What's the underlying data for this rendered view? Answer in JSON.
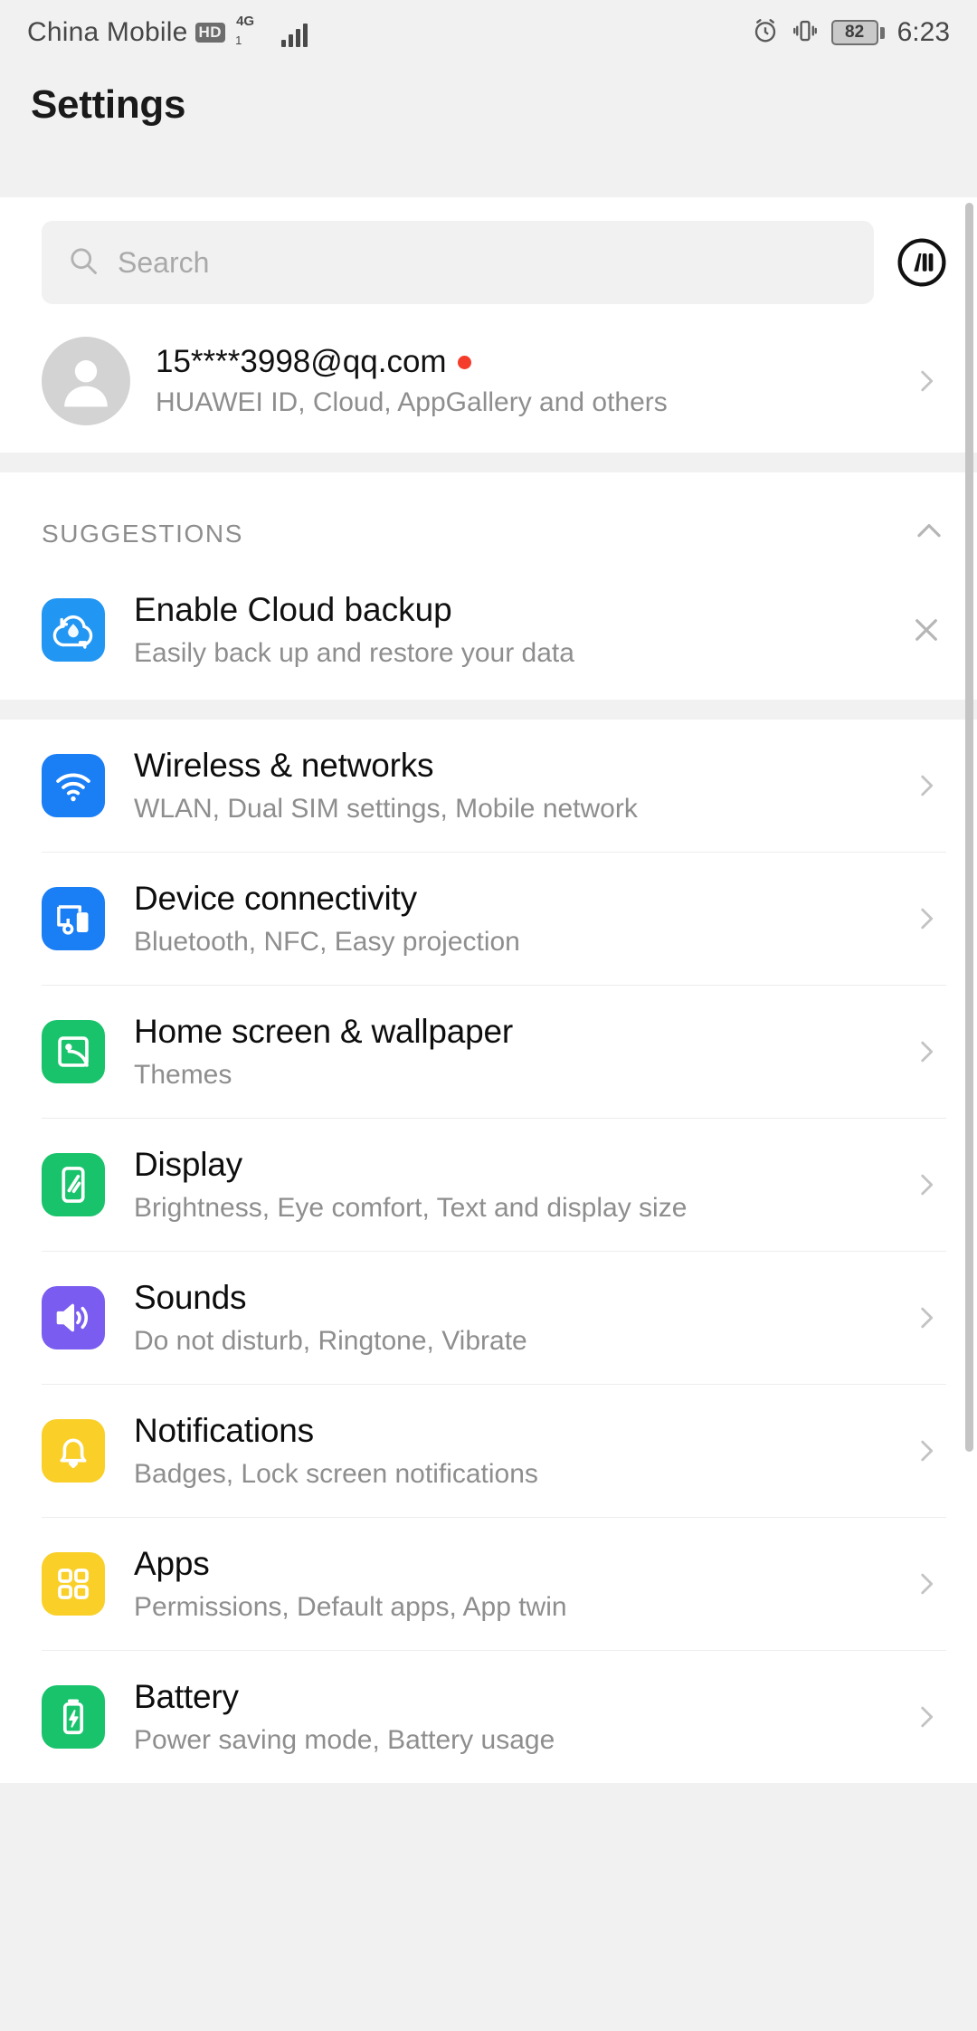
{
  "statusbar": {
    "carrier": "China Mobile",
    "hd_badge": "HD",
    "network_type": "4G",
    "network_sub": "1",
    "alarm_icon": "alarm-clock-icon",
    "vibrate_icon": "vibrate-icon",
    "battery_level": "82",
    "time": "6:23"
  },
  "header": {
    "title": "Settings"
  },
  "search": {
    "placeholder": "Search",
    "icon": "search-icon",
    "voice_icon": "hivoice-assistant-icon"
  },
  "account": {
    "name": "15****3998@qq.com",
    "subtitle": "HUAWEI ID, Cloud, AppGallery and others",
    "avatar_icon": "user-avatar-icon",
    "badge_color": "#f53c2a",
    "chevron": "chevron-right-icon"
  },
  "suggestions": {
    "section_label": "SUGGESTIONS",
    "collapse_icon": "chevron-up-icon",
    "items": [
      {
        "title": "Enable Cloud backup",
        "subtitle": "Easily back up and restore your data",
        "icon": "cloud-backup-icon",
        "icon_color": "#2196f3",
        "dismiss_icon": "close-icon"
      }
    ]
  },
  "settings_list": [
    {
      "title": "Wireless & networks",
      "subtitle": "WLAN, Dual SIM settings, Mobile network",
      "icon": "wifi-icon",
      "icon_color": "#1a7ef5"
    },
    {
      "title": "Device connectivity",
      "subtitle": "Bluetooth, NFC, Easy projection",
      "icon": "device-connectivity-icon",
      "icon_color": "#1a7ef5"
    },
    {
      "title": "Home screen & wallpaper",
      "subtitle": "Themes",
      "icon": "wallpaper-image-icon",
      "icon_color": "#19c36b"
    },
    {
      "title": "Display",
      "subtitle": "Brightness, Eye comfort, Text and display size",
      "icon": "display-brightness-icon",
      "icon_color": "#19c36b"
    },
    {
      "title": "Sounds",
      "subtitle": "Do not disturb, Ringtone, Vibrate",
      "icon": "speaker-volume-icon",
      "icon_color": "#7a5cf0"
    },
    {
      "title": "Notifications",
      "subtitle": "Badges, Lock screen notifications",
      "icon": "bell-icon",
      "icon_color": "#f9cf28"
    },
    {
      "title": "Apps",
      "subtitle": "Permissions, Default apps, App twin",
      "icon": "apps-grid-icon",
      "icon_color": "#f9cf28"
    },
    {
      "title": "Battery",
      "subtitle": "Power saving mode, Battery usage",
      "icon": "battery-charge-icon",
      "icon_color": "#19c36b"
    }
  ],
  "chevron_icon": "chevron-right-icon"
}
